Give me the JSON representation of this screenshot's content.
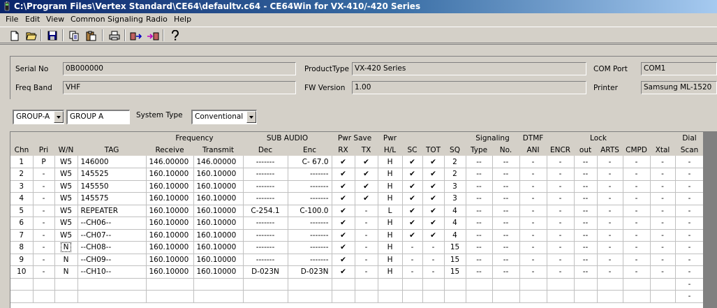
{
  "window": {
    "title": "C:\\Program Files\\Vertex Standard\\CE64\\defaultv.c64 - CE64Win for VX-410/-420 Series"
  },
  "menu": [
    "File",
    "Edit",
    "View",
    "Common",
    "Signaling",
    "Radio",
    "Help"
  ],
  "toolbar": [
    "new-icon",
    "open-icon",
    "save-icon",
    "copy-icon",
    "paste-icon",
    "print-icon",
    "read-radio-icon",
    "write-radio-icon",
    "help-icon"
  ],
  "info": {
    "serial_label": "Serial No",
    "serial_value": "0B000000",
    "product_label": "ProductType",
    "product_value": "VX-420 Series",
    "com_label": "COM Port",
    "com_value": "COM1",
    "band_label": "Freq Band",
    "band_value": "VHF",
    "fw_label": "FW Version",
    "fw_value": "1.00",
    "printer_label": "Printer",
    "printer_value": "Samsung ML-1520"
  },
  "group": {
    "combo_value": "GROUP-A",
    "name_value": "GROUP A",
    "system_type_label": "System Type",
    "system_type_value": "Conventional"
  },
  "grid": {
    "header_top": {
      "frequency": "Frequency",
      "sub_audio": "SUB AUDIO",
      "pwr_save": "Pwr Save",
      "pwr": "Pwr",
      "signaling": "Signaling",
      "dtmf": "DTMF",
      "lock": "Lock",
      "dial": "Dial"
    },
    "columns": [
      "Chn",
      "Pri",
      "W/N",
      "TAG",
      "Receive",
      "Transmit",
      "Dec",
      "Enc",
      "RX",
      "TX",
      "H/L",
      "SC",
      "TOT",
      "SQ",
      "Type",
      "No.",
      "ANI",
      "ENCR",
      "out",
      "ARTS",
      "CMPD",
      "Xtal",
      "Scan"
    ],
    "rows": [
      [
        "1",
        "P",
        "W5",
        "146000",
        "146.00000",
        "146.00000",
        "-------",
        "C- 67.0",
        "✔",
        "✔",
        "H",
        "✔",
        "✔",
        "2",
        "--",
        "--",
        "-",
        "-",
        "--",
        "-",
        "-",
        "-",
        "-"
      ],
      [
        "2",
        "-",
        "W5",
        "145525",
        "160.10000",
        "160.10000",
        "-------",
        "-------",
        "✔",
        "✔",
        "H",
        "✔",
        "✔",
        "2",
        "--",
        "--",
        "-",
        "-",
        "--",
        "-",
        "-",
        "-",
        "-"
      ],
      [
        "3",
        "-",
        "W5",
        "145550",
        "160.10000",
        "160.10000",
        "-------",
        "-------",
        "✔",
        "✔",
        "H",
        "✔",
        "✔",
        "3",
        "--",
        "--",
        "-",
        "-",
        "--",
        "-",
        "-",
        "-",
        "-"
      ],
      [
        "4",
        "-",
        "W5",
        "145575",
        "160.10000",
        "160.10000",
        "-------",
        "-------",
        "✔",
        "✔",
        "H",
        "✔",
        "✔",
        "3",
        "--",
        "--",
        "-",
        "-",
        "--",
        "-",
        "-",
        "-",
        "-"
      ],
      [
        "5",
        "-",
        "W5",
        "REPEATER",
        "160.10000",
        "160.10000",
        "C-254.1",
        "C-100.0",
        "✔",
        "-",
        "L",
        "✔",
        "✔",
        "4",
        "--",
        "--",
        "-",
        "-",
        "--",
        "-",
        "-",
        "-",
        "-"
      ],
      [
        "6",
        "-",
        "W5",
        "--CH06--",
        "160.10000",
        "160.10000",
        "-------",
        "-------",
        "✔",
        "-",
        "H",
        "✔",
        "✔",
        "4",
        "--",
        "--",
        "-",
        "-",
        "--",
        "-",
        "-",
        "-",
        "-"
      ],
      [
        "7",
        "-",
        "W5",
        "--CH07--",
        "160.10000",
        "160.10000",
        "-------",
        "-------",
        "✔",
        "-",
        "H",
        "✔",
        "✔",
        "4",
        "--",
        "--",
        "-",
        "-",
        "--",
        "-",
        "-",
        "-",
        "-"
      ],
      [
        "8",
        "-",
        "N",
        "--CH08--",
        "160.10000",
        "160.10000",
        "-------",
        "-------",
        "✔",
        "-",
        "H",
        "-",
        "-",
        "15",
        "--",
        "--",
        "-",
        "-",
        "--",
        "-",
        "-",
        "-",
        "-"
      ],
      [
        "9",
        "-",
        "N",
        "--CH09--",
        "160.10000",
        "160.10000",
        "-------",
        "-------",
        "✔",
        "-",
        "H",
        "-",
        "-",
        "15",
        "--",
        "--",
        "-",
        "-",
        "--",
        "-",
        "-",
        "-",
        "-"
      ],
      [
        "10",
        "-",
        "N",
        "--CH10--",
        "160.10000",
        "160.10000",
        "D-023N",
        "D-023N",
        "✔",
        "-",
        "H",
        "-",
        "-",
        "15",
        "--",
        "--",
        "-",
        "-",
        "--",
        "-",
        "-",
        "-",
        "-"
      ]
    ],
    "trailing_dash": "-"
  }
}
